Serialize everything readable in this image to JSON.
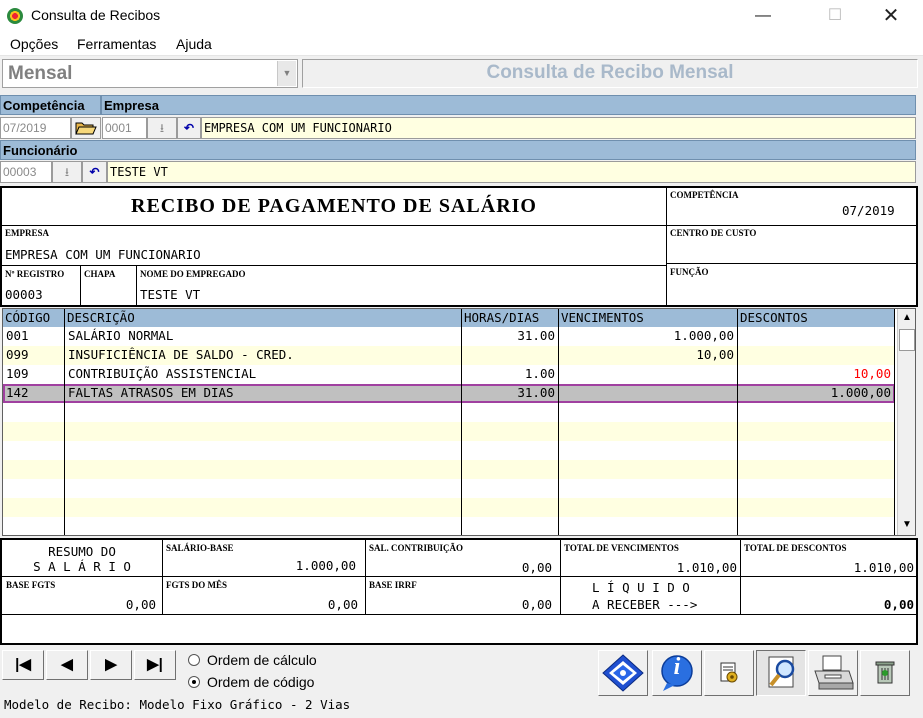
{
  "window": {
    "title": "Consulta de Recibos",
    "min_glyph": "—",
    "max_glyph": "☐",
    "close_glyph": "✕"
  },
  "menu": [
    "Opções",
    "Ferramentas",
    "Ajuda"
  ],
  "mode": {
    "value": "Mensal",
    "arrow": "▼",
    "title": "Consulta de Recibo Mensal"
  },
  "filters": {
    "competencia_label": "Competência",
    "competencia_value": "07/2019",
    "empresa_label": "Empresa",
    "empresa_code": "0001",
    "empresa_name": "EMPRESA COM UM FUNCIONARIO",
    "funcionario_label": "Funcionário",
    "funcionario_code": "00003",
    "funcionario_name": "TESTE VT",
    "download_glyph": "⭳",
    "undo_glyph": "↶"
  },
  "receipt": {
    "title": "RECIBO DE PAGAMENTO DE SALÁRIO",
    "competencia_label": "COMPETÊNCIA",
    "competencia_value": "07/2019",
    "empresa_label": "EMPRESA",
    "empresa_value": "EMPRESA COM UM FUNCIONARIO",
    "centro_label": "CENTRO DE CUSTO",
    "registro_label": "Nº REGISTRO",
    "registro_value": "00003",
    "chapa_label": "CHAPA",
    "nome_label": "NOME DO EMPREGADO",
    "nome_value": "TESTE VT",
    "funcao_label": "FUNÇÃO"
  },
  "grid": {
    "columns": [
      "CÓDIGO",
      "DESCRIÇÃO",
      "HORAS/DIAS",
      "VENCIMENTOS",
      "DESCONTOS"
    ],
    "rows": [
      {
        "codigo": "001",
        "descricao": "SALÁRIO NORMAL",
        "horas": "31.00",
        "vencimentos": "1.000,00",
        "descontos": ""
      },
      {
        "codigo": "099",
        "descricao": "INSUFICIÊNCIA DE SALDO - CRED.",
        "horas": "",
        "vencimentos": "10,00",
        "descontos": ""
      },
      {
        "codigo": "109",
        "descricao": "CONTRIBUIÇÃO ASSISTENCIAL",
        "horas": "1.00",
        "vencimentos": "",
        "descontos": "10,00"
      },
      {
        "codigo": "142",
        "descricao": "FALTAS ATRASOS EM DIAS",
        "horas": "31.00",
        "vencimentos": "",
        "descontos": "1.000,00"
      }
    ],
    "selected_row": 3,
    "scroll_up": "▲",
    "scroll_down": "▼"
  },
  "summary": {
    "resumo_line1": "RESUMO DO",
    "resumo_line2": "S A L Á R I O",
    "salario_base_label": "SALÁRIO-BASE",
    "salario_base_value": "1.000,00",
    "sal_contrib_label": "SAL. CONTRIBUIÇÃO",
    "sal_contrib_value": "0,00",
    "total_venc_label": "TOTAL DE VENCIMENTOS",
    "total_venc_value": "1.010,00",
    "total_desc_label": "TOTAL DE DESCONTOS",
    "total_desc_value": "1.010,00",
    "base_fgts_label": "BASE FGTS",
    "base_fgts_value": "0,00",
    "fgts_mes_label": "FGTS DO MÊS",
    "fgts_mes_value": "0,00",
    "base_irrf_label": "BASE IRRF",
    "base_irrf_value": "0,00",
    "liquido_line1": "L Í Q U I D O",
    "liquido_line2": "A RECEBER --->",
    "liquido_value": "0,00"
  },
  "nav": {
    "first": "|◀",
    "prev": "◀",
    "next": "▶",
    "last": "▶|"
  },
  "order": {
    "option1": "Ordem de cálculo",
    "option2": "Ordem de código",
    "selected": 2
  },
  "toolbar": {
    "info_glyph": "i"
  },
  "status": "Modelo de Recibo: Modelo Fixo Gráfico - 2 Vias",
  "colors": {
    "header_blue": "#9dbbd7",
    "row_yellow": "#ffffe1",
    "selected_row": "#c0c0c0",
    "selected_border": "#a040a0",
    "negative": "#ff0000"
  }
}
